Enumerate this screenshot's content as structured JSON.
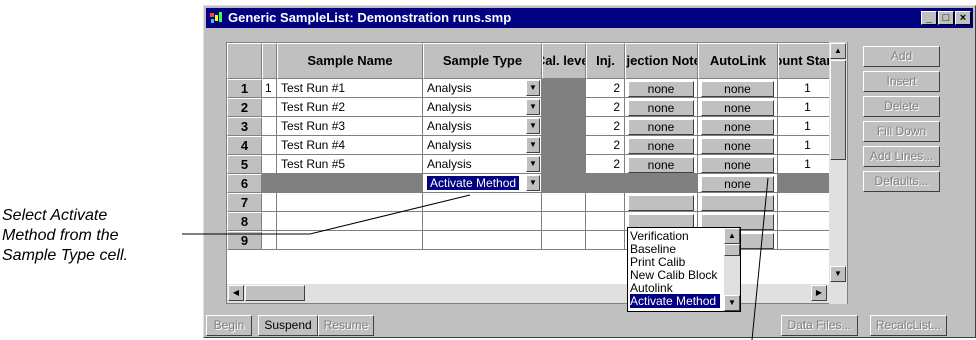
{
  "callout": {
    "lines": [
      "Select Activate",
      "Method from the",
      "Sample Type cell."
    ]
  },
  "window": {
    "title": "Generic SampleList: Demonstration runs.smp",
    "buttons": [
      "_",
      "□",
      "×"
    ]
  },
  "grid": {
    "headers": {
      "sample_name": "Sample Name",
      "sample_type": "Sample Type",
      "cal_level": "Cal. level",
      "inj": "Inj.",
      "injection_notes": "Injection Notes",
      "autolink": "AutoLink",
      "amount": "Amount Standard"
    },
    "rows": [
      {
        "num": "1",
        "mark": "1",
        "name": "Test Run #1",
        "type": "Analysis",
        "inj": "2",
        "notes": "none",
        "autolink": "none",
        "amount": "1"
      },
      {
        "num": "2",
        "mark": "",
        "name": "Test Run #2",
        "type": "Analysis",
        "inj": "2",
        "notes": "none",
        "autolink": "none",
        "amount": "1"
      },
      {
        "num": "3",
        "mark": "",
        "name": "Test Run #3",
        "type": "Analysis",
        "inj": "2",
        "notes": "none",
        "autolink": "none",
        "amount": "1"
      },
      {
        "num": "4",
        "mark": "",
        "name": "Test Run #4",
        "type": "Analysis",
        "inj": "2",
        "notes": "none",
        "autolink": "none",
        "amount": "1"
      },
      {
        "num": "5",
        "mark": "",
        "name": "Test Run #5",
        "type": "Analysis",
        "inj": "2",
        "notes": "none",
        "autolink": "none",
        "amount": "1"
      },
      {
        "num": "6",
        "mark": "",
        "name": "",
        "type": "Activate Method",
        "inj": "",
        "notes": "",
        "autolink": "none",
        "amount": ""
      },
      {
        "num": "7"
      },
      {
        "num": "8"
      },
      {
        "num": "9"
      }
    ]
  },
  "dropdown": {
    "options": [
      "Verification",
      "Baseline",
      "Print Calib",
      "New Calib Block",
      "Autolink",
      "Activate Method"
    ],
    "selected": "Activate Method"
  },
  "side_buttons": [
    "Add",
    "Insert",
    "Delete",
    "Fill Down",
    "Add Lines...",
    "Defaults..."
  ],
  "bottom_buttons": {
    "begin": "Begin",
    "suspend": "Suspend",
    "resume": "Resume",
    "data_files": "Data Files...",
    "recalc": "RecalcList..."
  }
}
